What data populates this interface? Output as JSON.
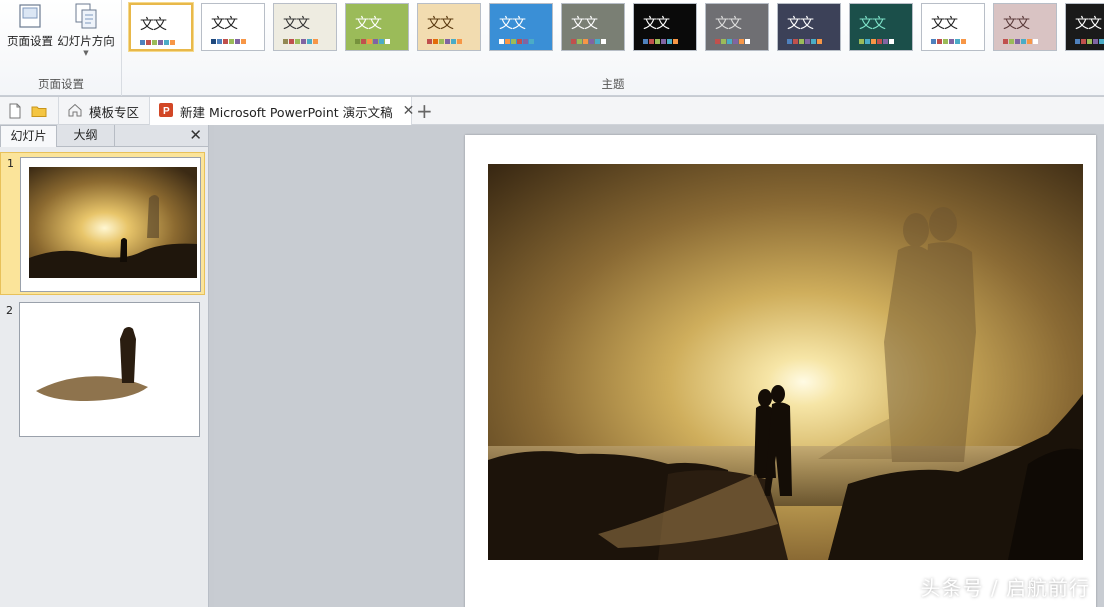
{
  "ribbon": {
    "page_setup_label": "页面设置",
    "slide_orientation_label": "幻灯片方向",
    "page_setup_group": "页面设置",
    "themes_group": "主题",
    "themes": [
      {
        "text": "文文",
        "bg": "#ffffff",
        "fg": "#222222",
        "bars": [
          "#4f81bd",
          "#c0504d",
          "#9bbb59",
          "#8064a2",
          "#4bacc6",
          "#f79646"
        ],
        "selected": true
      },
      {
        "text": "文文",
        "bg": "#ffffff",
        "fg": "#222222",
        "bars": [
          "#1f497d",
          "#4f81bd",
          "#c0504d",
          "#9bbb59",
          "#8064a2",
          "#f79646"
        ],
        "selected": false
      },
      {
        "text": "文文",
        "bg": "#eeece1",
        "fg": "#333333",
        "bars": [
          "#938953",
          "#c0504d",
          "#9bbb59",
          "#8064a2",
          "#4bacc6",
          "#f79646"
        ],
        "selected": false
      },
      {
        "text": "文文",
        "bg": "#9bbb59",
        "fg": "#ffffff",
        "bars": [
          "#76923c",
          "#c0504d",
          "#f79646",
          "#8064a2",
          "#4bacc6",
          "#ffffff"
        ],
        "selected": false
      },
      {
        "text": "文文",
        "bg": "#f2dcb0",
        "fg": "#5a3a10",
        "bars": [
          "#c0504d",
          "#e36c09",
          "#9bbb59",
          "#8064a2",
          "#4bacc6",
          "#f79646"
        ],
        "selected": false
      },
      {
        "text": "文文",
        "bg": "#3a8fd6",
        "fg": "#ffffff",
        "bars": [
          "#ffffff",
          "#f79646",
          "#9bbb59",
          "#c0504d",
          "#8064a2",
          "#4bacc6"
        ],
        "selected": false
      },
      {
        "text": "文文",
        "bg": "#7a7f74",
        "fg": "#ffffff",
        "bars": [
          "#c0504d",
          "#9bbb59",
          "#f79646",
          "#8064a2",
          "#4bacc6",
          "#ffffff"
        ],
        "selected": false
      },
      {
        "text": "文文",
        "bg": "#0a0a0a",
        "fg": "#ffffff",
        "bars": [
          "#4f81bd",
          "#c0504d",
          "#9bbb59",
          "#8064a2",
          "#4bacc6",
          "#f79646"
        ],
        "selected": false
      },
      {
        "text": "文文",
        "bg": "#6f6f73",
        "fg": "#dddddd",
        "bars": [
          "#c0504d",
          "#9bbb59",
          "#4bacc6",
          "#8064a2",
          "#f79646",
          "#ffffff"
        ],
        "selected": false
      },
      {
        "text": "文文",
        "bg": "#3c4158",
        "fg": "#ffffff",
        "bars": [
          "#4f81bd",
          "#c0504d",
          "#9bbb59",
          "#8064a2",
          "#4bacc6",
          "#f79646"
        ],
        "selected": false
      },
      {
        "text": "文文",
        "bg": "#1b4f4a",
        "fg": "#7ee3c9",
        "bars": [
          "#9bbb59",
          "#4bacc6",
          "#f79646",
          "#c0504d",
          "#8064a2",
          "#ffffff"
        ],
        "selected": false
      },
      {
        "text": "文文",
        "bg": "#ffffff",
        "fg": "#222222",
        "bars": [
          "#4f81bd",
          "#c0504d",
          "#9bbb59",
          "#8064a2",
          "#4bacc6",
          "#f79646"
        ],
        "selected": false
      },
      {
        "text": "文文",
        "bg": "#d9c3c3",
        "fg": "#5a3a3a",
        "bars": [
          "#c0504d",
          "#9bbb59",
          "#8064a2",
          "#4bacc6",
          "#f79646",
          "#ffffff"
        ],
        "selected": false
      },
      {
        "text": "文文",
        "bg": "#1a1a1a",
        "fg": "#ffffff",
        "bars": [
          "#4f81bd",
          "#c0504d",
          "#9bbb59",
          "#8064a2",
          "#4bacc6",
          "#f79646"
        ],
        "selected": false
      }
    ]
  },
  "tabs": {
    "template_zone": "模板专区",
    "document": "新建 Microsoft PowerPoint 演示文稿",
    "close": "✕",
    "add": "+"
  },
  "panel": {
    "tab_slides": "幻灯片",
    "tab_outline": "大纲",
    "close": "✕",
    "slides": [
      {
        "number": "1"
      },
      {
        "number": "2"
      }
    ]
  },
  "watermark": "头条号 / 启航前行",
  "colors": {
    "selection": "#fbe49a",
    "selection_border": "#e8c15a",
    "accent_theme_border": "#e8b84a",
    "ppt_icon": "#d24726"
  }
}
